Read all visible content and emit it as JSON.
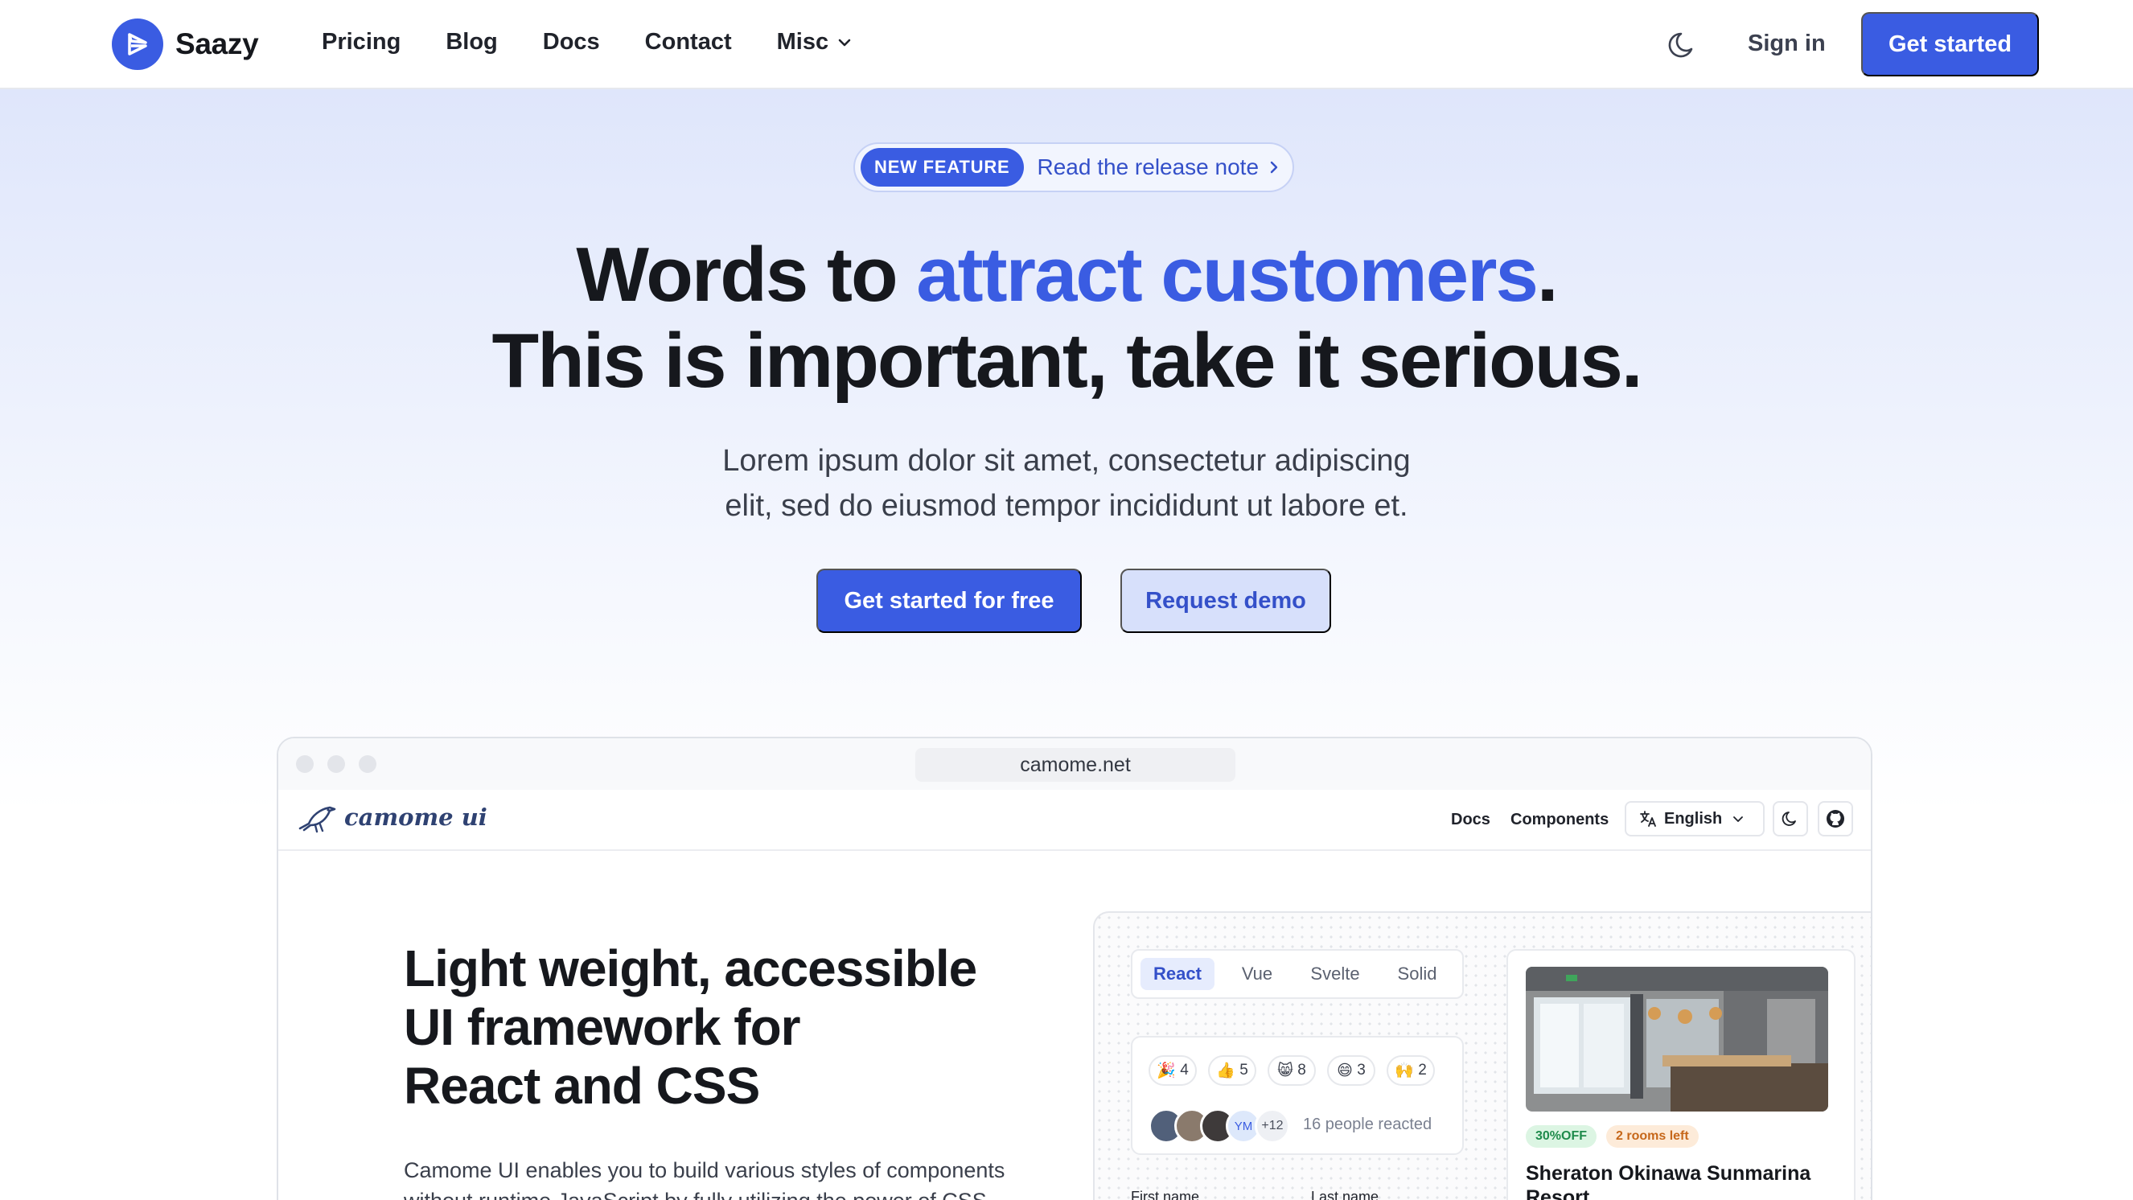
{
  "nav": {
    "brand": "Saazy",
    "links": [
      "Pricing",
      "Blog",
      "Docs",
      "Contact",
      "Misc"
    ],
    "sign_in": "Sign in",
    "get_started": "Get started"
  },
  "hero": {
    "badge": "NEW FEATURE",
    "release_note": "Read the release note",
    "headline_part1": "Words to ",
    "headline_accent": "attract customers",
    "headline_part2": ".",
    "headline_line2": "This is important, take it serious.",
    "subtext_line1": "Lorem ipsum dolor sit amet, consectetur adipiscing",
    "subtext_line2": "elit, sed do eiusmod tempor incididunt ut labore et.",
    "cta_primary": "Get started for free",
    "cta_secondary": "Request demo"
  },
  "browser": {
    "url": "camome.net",
    "app_name": "camome ui",
    "nav_links": [
      "Docs",
      "Components"
    ],
    "language": "English",
    "title_line1": "Light weight, accessible",
    "title_line2": "UI framework for",
    "title_line3": "React and CSS",
    "description_line1": "Camome UI enables you to build various styles of components",
    "description_line2": "without runtime JavaScript by fully utilizing the power of CSS.",
    "framework_tabs": [
      "React",
      "Vue",
      "Svelte",
      "Solid"
    ],
    "reactions": [
      {
        "emoji": "🎉",
        "count": "4"
      },
      {
        "emoji": "👍",
        "count": "5"
      },
      {
        "emoji": "😸",
        "count": "8"
      },
      {
        "emoji": "😄",
        "count": "3"
      },
      {
        "emoji": "🙌",
        "count": "2"
      }
    ],
    "avatar_initials": "YM",
    "avatar_more": "+12",
    "reacted_text": "16 people reacted",
    "field_first": "First name",
    "field_last": "Last name",
    "hotel": {
      "discount": "30%OFF",
      "rooms_left": "2 rooms left",
      "name": "Sheraton Okinawa Sunmarina Resort"
    }
  },
  "colors": {
    "accent": "#3a5ce2",
    "accent_light": "#d7e0fb",
    "text_dark": "#16181d"
  },
  "icons": [
    "logo-icon",
    "chevron-down-icon",
    "moon-icon",
    "chevron-right-icon",
    "bird-icon",
    "translate-icon",
    "github-icon"
  ]
}
